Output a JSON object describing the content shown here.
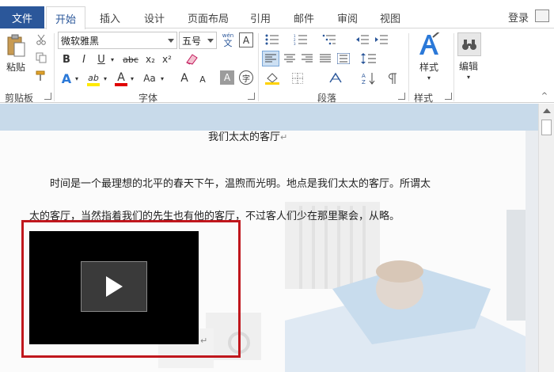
{
  "tabs": {
    "file": "文件",
    "items": [
      "开始",
      "插入",
      "设计",
      "页面布局",
      "引用",
      "邮件",
      "审阅",
      "视图"
    ],
    "login": "登录"
  },
  "ribbon": {
    "clipboard": {
      "paste": "粘贴",
      "label": "剪贴板"
    },
    "font": {
      "name": "微软雅黑",
      "size": "五号",
      "wen": "wén",
      "wen_char": "文",
      "A_box": "A",
      "bold": "B",
      "italic": "I",
      "underline": "U",
      "strike": "abc",
      "sub": "x₂",
      "sup": "x²",
      "effects": "A",
      "highlight": "ab",
      "color": "A",
      "case": "Aa",
      "grow": "A",
      "shrink": "A",
      "shade": "A",
      "circle": "字",
      "label": "字体"
    },
    "paragraph": {
      "label": "段落"
    },
    "styles": {
      "button": "样式",
      "label": "样式"
    },
    "editing": {
      "button": "编辑"
    }
  },
  "document": {
    "title": "我们太太的客厅",
    "para_mark": "↵",
    "line1": "时间是一个最理想的北平的春天下午，温煦而光明。地点是我们太太的客厅。所谓太",
    "line2": "太的客厅，当然指着我们的先生也有他的客厅，不过客人们少在那里聚会，从略。",
    "after_video_mark": "↵"
  }
}
